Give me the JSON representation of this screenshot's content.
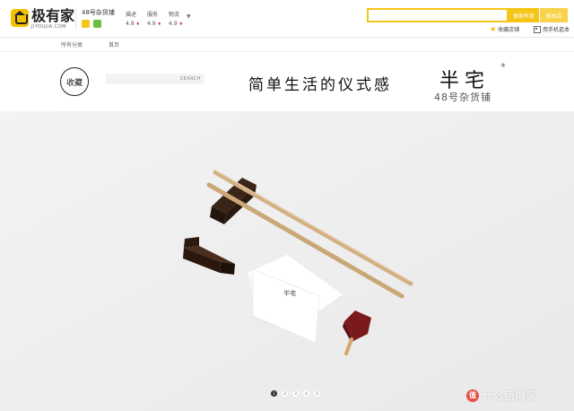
{
  "header": {
    "logo_cn": "极有家",
    "logo_en": "JIYOUJIA.COM",
    "shop_name": "48号杂货铺",
    "ratings": [
      {
        "label": "描述",
        "score": "4.9"
      },
      {
        "label": "服务",
        "score": "4.9"
      },
      {
        "label": "物流",
        "score": "4.9"
      }
    ],
    "search": {
      "placeholder": "",
      "btn_global": "搜索有家",
      "btn_shop": "搜本店"
    },
    "fav_label": "收藏店铺",
    "mobile_label": "用手机逛本"
  },
  "nav": {
    "all": "所有分类",
    "home": "首页"
  },
  "banner": {
    "stamp": "收藏",
    "search_btn": "SEARCH",
    "slogan": "简单生活的仪式感",
    "brand": "半宅",
    "brand_reg": "®",
    "brand_sub": "48号杂货铺"
  },
  "hero": {
    "card_text": "半宅",
    "background": "#efefef"
  },
  "carousel": {
    "pages": [
      "1",
      "2",
      "3",
      "4",
      "5"
    ],
    "active": 1
  },
  "watermark": {
    "icon": "值",
    "text": "什么值得买"
  }
}
